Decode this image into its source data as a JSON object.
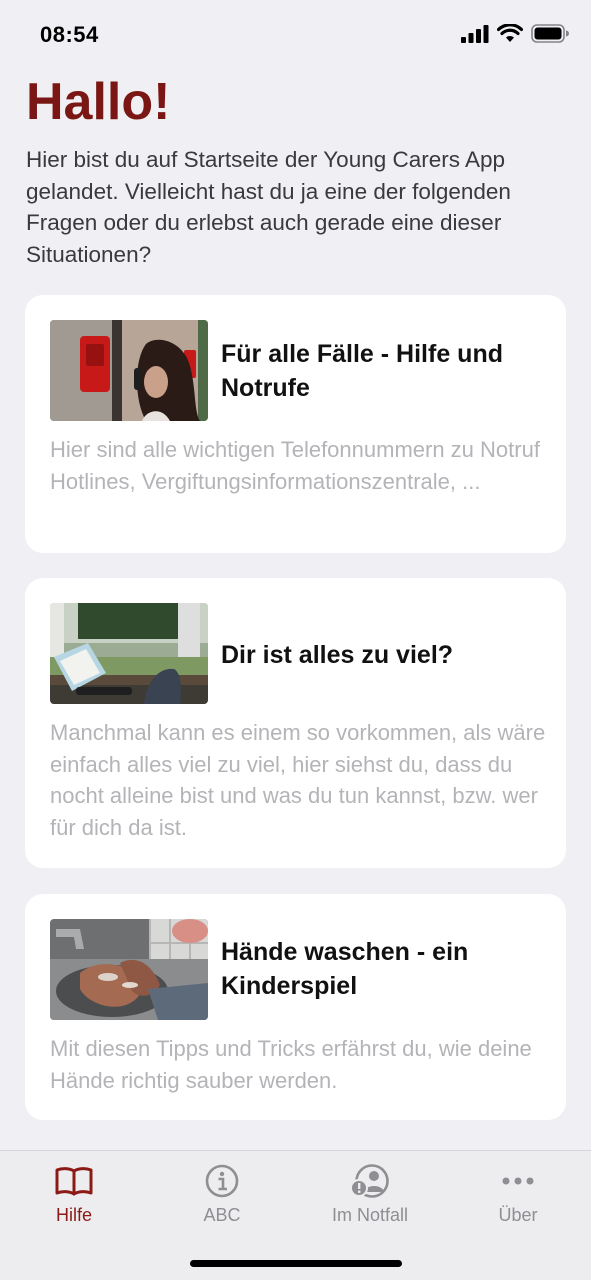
{
  "status_bar": {
    "time": "08:54"
  },
  "page": {
    "title": "Hallo!",
    "intro": "Hier bist du auf Startseite der Young Carers App gelandet. Vielleicht hast du ja eine der folgenden Fragen oder du erlebst auch gerade eine dieser Situationen?"
  },
  "cards": [
    {
      "title": "Für alle Fälle - Hilfe und Notrufe",
      "description": "Hier sind alle wichtigen Telefonnummern zu Notruf Hotlines, Vergiftungsinformationszentrale, ..."
    },
    {
      "title": "Dir ist alles zu viel?",
      "description": "Manchmal kann es einem so vorkommen, als wäre einfach alles viel zu viel, hier siehst du, dass du nocht alleine bist und was du tun kannst, bzw. wer für dich da ist."
    },
    {
      "title": "Hände waschen - ein Kinderspiel",
      "description": "Mit diesen Tipps und Tricks erfährst du, wie deine Hände richtig sauber werden."
    }
  ],
  "tab_bar": {
    "tabs": [
      {
        "label": "Hilfe",
        "icon": "book-icon",
        "active": true
      },
      {
        "label": "ABC",
        "icon": "info-icon",
        "active": false
      },
      {
        "label": "Im Notfall",
        "icon": "person-alert-icon",
        "active": false
      },
      {
        "label": "Über",
        "icon": "more-icon",
        "active": false
      }
    ]
  },
  "colors": {
    "accent": "#7a1613",
    "background": "#f0eff4",
    "card": "#ffffff",
    "muted_text": "#b4b4b8",
    "inactive_tab": "#8e8e93"
  }
}
